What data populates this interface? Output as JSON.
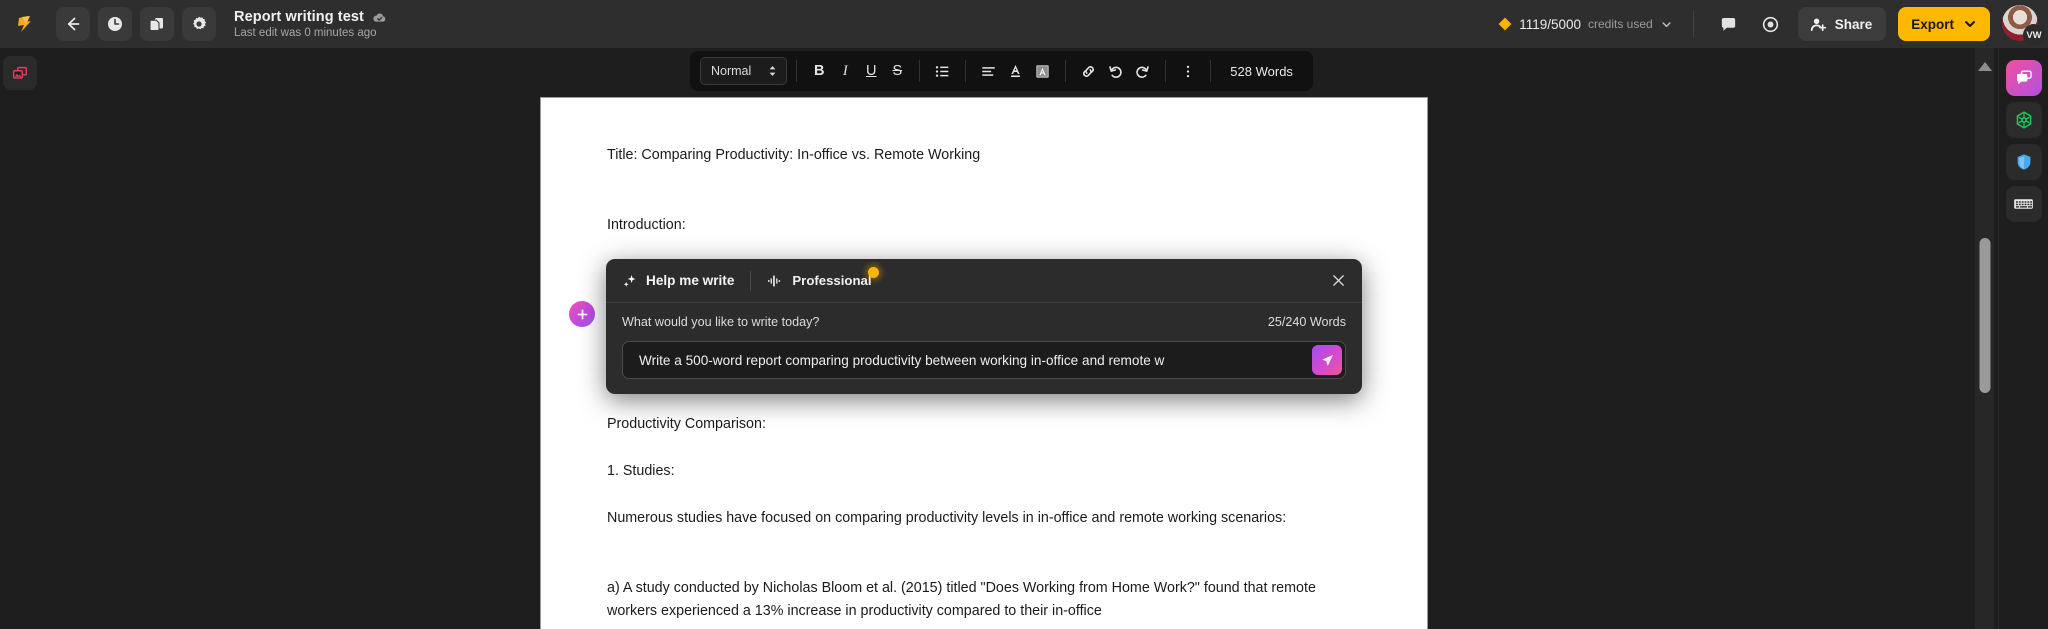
{
  "header": {
    "logo_icon": "app-logo-icon",
    "back_icon": "back-arrow-icon",
    "history_icon": "clock-history-icon",
    "duplicate_icon": "duplicate-documents-icon",
    "settings_icon": "gear-icon",
    "doc_title": "Report writing test",
    "cloud_saved_icon": "cloud-saved-icon",
    "doc_subtitle": "Last edit was 0 minutes ago",
    "credits_icon": "diamond-credits-icon",
    "credits_value": "1119/5000",
    "credits_label": "credits used",
    "credits_caret_icon": "chevron-down-icon",
    "comment_icon": "comment-bubble-icon",
    "preview_icon": "eye-preview-icon",
    "share_icon": "add-person-icon",
    "share_label": "Share",
    "export_label": "Export",
    "export_caret_icon": "chevron-down-icon",
    "avatar_initials": "VW",
    "accent_yellow": "#ffb800",
    "header_bg": "#2e2e2e"
  },
  "left_rail": {
    "capture_icon": "screen-capture-icon"
  },
  "toolbar": {
    "style_value": "Normal",
    "style_caret_icon": "updown-caret-icon",
    "bold_label": "B",
    "italic_label": "I",
    "underline_label": "U",
    "strike_label": "S",
    "list_icon": "bulleted-list-icon",
    "align_icon": "align-left-icon",
    "text_color_icon": "text-color-icon",
    "highlight_icon": "highlight-color-icon",
    "link_icon": "link-icon",
    "undo_icon": "undo-icon",
    "redo_icon": "redo-icon",
    "more_icon": "more-vertical-icon",
    "word_count": "528 Words"
  },
  "document": {
    "add_block_icon": "plus-icon",
    "blocks": [
      "Title: Comparing Productivity: In-office vs. Remote Working",
      "Introduction:",
      "Productivity Comparison:",
      "1. Studies:",
      "Numerous studies have focused on comparing productivity levels in in-office and remote working scenarios:",
      "a) A study conducted by Nicholas Bloom et al. (2015) titled \"Does Working from Home Work?\" found that remote workers experienced a 13% increase in productivity compared to their in-office"
    ]
  },
  "help_panel": {
    "sparkle_icon": "sparkle-icon",
    "title": "Help me write",
    "tone_icon": "tone-waveform-icon",
    "tone_label": "Professional",
    "tone_dot_color": "#ffb400",
    "close_icon": "close-icon",
    "prompt_question": "What would you like to write today?",
    "word_counter": "25/240 Words",
    "prompt_value": "Write a 500-word report comparing productivity between working in-office and remote w",
    "prompt_placeholder": "What would you like to write today?",
    "send_icon": "send-paper-plane-icon"
  },
  "right_rail": {
    "items": [
      {
        "icon": "chat-bubbles-icon",
        "name": "chat-assistant-button"
      },
      {
        "icon": "green-hexagon-icon",
        "name": "extension-button"
      },
      {
        "icon": "blue-shield-icon",
        "name": "security-shield-button"
      },
      {
        "icon": "keyboard-icon",
        "name": "keyboard-shortcuts-button"
      }
    ]
  },
  "scrollbar": {
    "up_arrow_icon": "scroll-up-arrow-icon"
  }
}
